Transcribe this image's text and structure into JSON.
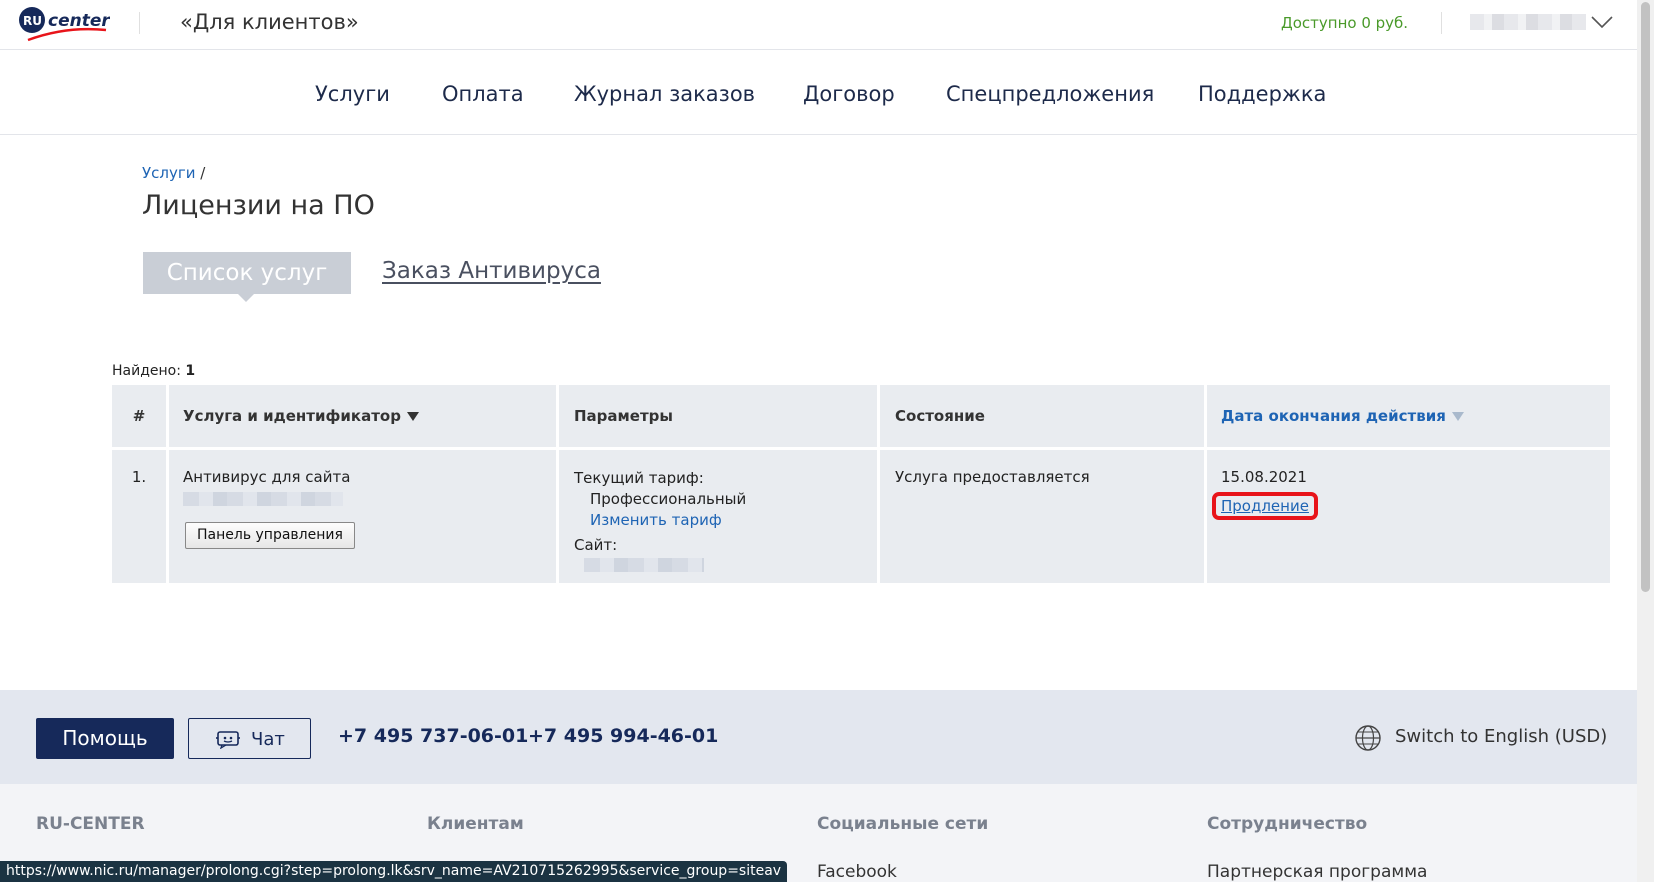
{
  "header": {
    "logo_text": "RU center",
    "site_title": "«Для клиентов»",
    "balance": "Доступно 0 руб.",
    "account_chevron_icon": "chevron-down-icon"
  },
  "nav": {
    "items": [
      "Услуги",
      "Оплата",
      "Журнал заказов",
      "Договор",
      "Спецпредложения",
      "Поддержка"
    ]
  },
  "breadcrumb": {
    "link": "Услуги",
    "separator": "/"
  },
  "page_title": "Лицензии на ПО",
  "tabs": {
    "active": "Список услуг",
    "other": "Заказ Антивируса"
  },
  "found": {
    "label": "Найдено:",
    "count": "1"
  },
  "table": {
    "headers": [
      "#",
      "Услуга и идентификатор",
      "Параметры",
      "Состояние",
      "Дата окончания действия"
    ],
    "rows": [
      {
        "num": "1.",
        "service": "Антивирус для сайта",
        "panel_button": "Панель управления",
        "tariff_label": "Текущий тариф:",
        "tariff_value": "Профессиональный",
        "change_tariff": "Изменить тариф",
        "site_label": "Сайт:",
        "status": "Услуга предоставляется",
        "end_date": "15.08.2021",
        "renew_link": "Продление"
      }
    ]
  },
  "footer": {
    "help_button": "Помощь",
    "chat_button": "Чат",
    "phones": [
      "+7 495 737-06-01",
      "+7 495 994-46-01"
    ],
    "language": "Switch to English (USD)",
    "columns": [
      {
        "title": "RU-CENTER",
        "link": ""
      },
      {
        "title": "Клиентам",
        "link": ""
      },
      {
        "title": "Социальные сети",
        "link": "Facebook"
      },
      {
        "title": "Сотрудничество",
        "link": "Партнерская программа"
      }
    ]
  },
  "status_url": "https://www.nic.ru/manager/prolong.cgi?step=prolong.lk&srv_name=AV210715262995&service_group=siteav",
  "colors": {
    "accent": "#1e64b4",
    "navy": "#16295a",
    "highlight": "#e8141a",
    "balance": "#4a9a2a"
  }
}
